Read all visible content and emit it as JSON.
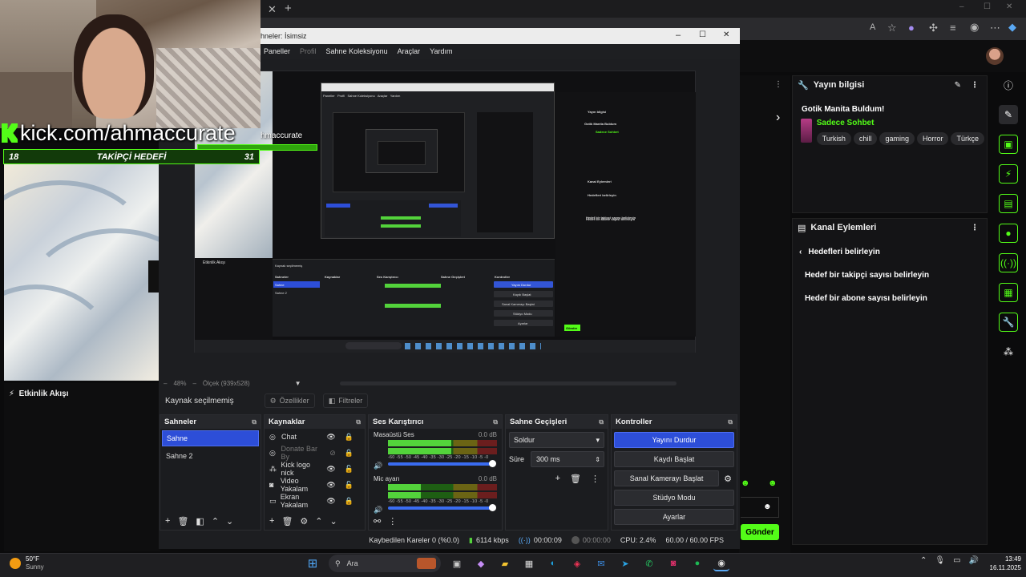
{
  "browser": {
    "tab_close": "✕",
    "tab_new": "+",
    "win_min": "–",
    "win_max": "☐",
    "win_close": "✕"
  },
  "overlay": {
    "kick_url": "kick.com/ahmaccurate",
    "goal_label": "TAKİPÇİ HEDEFİ",
    "goal_current": "18",
    "goal_target": "31",
    "nested_handle": "hmaccurate"
  },
  "obs": {
    "title": "hneler: İsimsiz",
    "menu": [
      "Paneller",
      "Profil",
      "Sahne Koleksiyonu",
      "Araçlar",
      "Yardım"
    ],
    "zoom": "48%",
    "scale_label": "Ölçek (939x528)",
    "no_source": "Kaynak seçilmemiş",
    "properties": "Özellikler",
    "filters": "Filtreler",
    "scenes": {
      "title": "Sahneler",
      "items": [
        "Sahne",
        "Sahne 2"
      ]
    },
    "sources": {
      "title": "Kaynaklar",
      "items": [
        "Chat",
        "Donate Bar By",
        "Kick logo nick",
        "Video Yakalam",
        "Ekran Yakalam"
      ]
    },
    "mixer": {
      "title": "Ses Karıştırıcı",
      "channels": [
        {
          "name": "Masaüstü Ses",
          "db": "0.0 dB",
          "level": 0.58
        },
        {
          "name": "Mic ayarı",
          "db": "0.0 dB",
          "level": 0.3
        }
      ],
      "scale": "-60 -55 -50 -45 -40 -35 -30 -25 -20 -15 -10 -5 -0"
    },
    "transitions": {
      "title": "Sahne Geçişleri",
      "selected": "Soldur",
      "duration_label": "Süre",
      "duration_value": "300 ms"
    },
    "controls": {
      "title": "Kontroller",
      "stop_stream": "Yayını Durdur",
      "start_record": "Kaydı Başlat",
      "start_vcam": "Sanal Kamerayı Başlat",
      "studio_mode": "Stüdyo Modu",
      "settings": "Ayarlar"
    },
    "status": {
      "dropped": "Kaybedilen Kareler 0 (%0.0)",
      "bitrate": "6114 kbps",
      "live_time": "00:00:09",
      "rec_time": "00:00:00",
      "cpu": "CPU: 2.4%",
      "fps": "60.00 / 60.00 FPS"
    }
  },
  "nested": {
    "panel_title": "Yayın bilgisi",
    "stream_title": "Gotik Manita Buldum",
    "category": "Sadece Sohbet",
    "actions_title": "Kanal Eylemleri",
    "goal_back": "Hedefleri belirleyin",
    "goal_follow": "Hedef bir takipçi sayısı belirleyin",
    "goal_sub": "Hedef bir abone sayısı belirleyin",
    "activity": "Etkinlik Akışı",
    "scenes": "Sahneler",
    "sources": "Kaynaklar",
    "mixer": "Ses Karıştırıcı",
    "transitions": "Sahne Geçişleri",
    "controls": "Kontroller",
    "stop": "Yayını Durdur",
    "record": "Kaydı Başlat",
    "vcam": "Sanal Kamerayı Başlat",
    "studio": "Stüdyo Modu",
    "settings": "Ayarlar",
    "scene1": "Sahne",
    "scene2": "Sahne 2",
    "send": "Gönder",
    "no_source": "Kaynak seçilmemiş"
  },
  "kick": {
    "info_title": "Yayın bilgisi",
    "stream_title": "Gotik Manita Buldum!",
    "category": "Sadece Sohbet",
    "tags": [
      "Turkish",
      "chill",
      "gaming",
      "Horror",
      "Türkçe"
    ],
    "actions_title": "Kanal Eylemleri",
    "goal_back": "Hedefleri belirleyin",
    "goal_follow": "Hedef bir takipçi sayısı belirleyin",
    "goal_sub": "Hedef bir abone sayısı belirleyin",
    "activity_title": "Etkinlik Akışı",
    "send": "Gönder",
    "accent": "#53fc18"
  },
  "taskbar": {
    "temp": "50°F",
    "condition": "Sunny",
    "search": "Ara",
    "time": "13:49",
    "date": "16.11.2025"
  }
}
